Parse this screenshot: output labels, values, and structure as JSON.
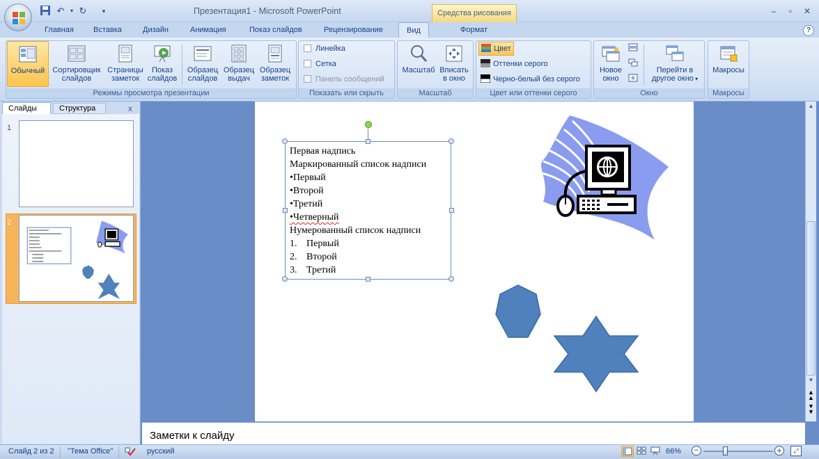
{
  "window": {
    "title": "Презентация1 - Microsoft PowerPoint",
    "context_tab": "Средства рисования"
  },
  "tabs": [
    "Главная",
    "Вставка",
    "Дизайн",
    "Анимация",
    "Показ слайдов",
    "Рецензирование",
    "Вид",
    "Формат"
  ],
  "active_tab": "Вид",
  "ribbon": {
    "groups": {
      "views": {
        "label": "Режимы просмотра презентации",
        "normal": "Обычный",
        "sorter": [
          "Сортировщик",
          "слайдов"
        ],
        "notes_page": [
          "Страницы",
          "заметок"
        ],
        "slide_show": [
          "Показ",
          "слайдов"
        ],
        "slide_master": [
          "Образец",
          "слайдов"
        ],
        "handout_master": [
          "Образец",
          "выдач"
        ],
        "notes_master": [
          "Образец",
          "заметок"
        ]
      },
      "show_hide": {
        "label": "Показать или скрыть",
        "ruler": "Линейка",
        "grid": "Сетка",
        "message_bar": "Панель сообщений"
      },
      "zoom": {
        "label": "Масштаб",
        "zoom": "Масштаб",
        "fit": [
          "Вписать",
          "в окно"
        ]
      },
      "color": {
        "label": "Цвет или оттенки серого",
        "color": "Цвет",
        "grayscale": "Оттенки серого",
        "bw": "Черно-белый без серого"
      },
      "window": {
        "label": "Окно",
        "new_window": [
          "Новое",
          "окно"
        ],
        "switch": [
          "Перейти в",
          "другое окно"
        ]
      },
      "macros": {
        "label": "Макросы",
        "macros": "Макросы"
      }
    }
  },
  "panel": {
    "tab_slides": "Слайды",
    "tab_outline": "Структура",
    "close": "x",
    "slide_numbers": [
      "1",
      "2"
    ]
  },
  "slide": {
    "textbox_lines": [
      "Первая надпись",
      "Маркированный список надписи",
      "•Первый",
      "•Второй",
      "•Третий",
      "•Четверный",
      "Нумерованный список надписи"
    ],
    "numbered": [
      {
        "num": "1.",
        "text": "Первый"
      },
      {
        "num": "2.",
        "text": "Второй"
      },
      {
        "num": "3.",
        "text": "Третий"
      }
    ],
    "shape_color": "#4f81bd"
  },
  "notes": {
    "placeholder": "Заметки к слайду"
  },
  "status": {
    "slide_of": "Слайд 2 из 2",
    "theme": "\"Тема Office\"",
    "language": "русский",
    "zoom": "66%"
  },
  "colors": {
    "accent": "#15428b",
    "ribbon": "#d6e3f4",
    "selected_thumb": "#f7b45a"
  }
}
